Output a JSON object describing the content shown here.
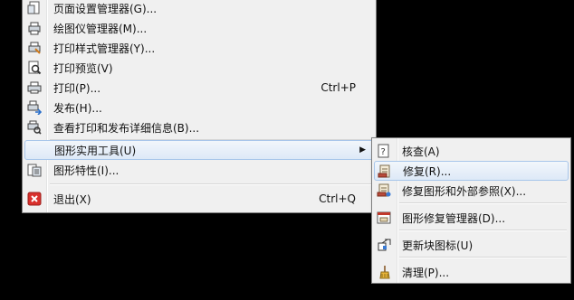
{
  "main_menu": {
    "items": [
      {
        "label": "页面设置管理器(G)...",
        "shortcut": "",
        "icon": "page-setup-icon"
      },
      {
        "label": "绘图仪管理器(M)...",
        "shortcut": "",
        "icon": "plotter-manager-icon"
      },
      {
        "label": "打印样式管理器(Y)...",
        "shortcut": "",
        "icon": "plot-style-icon"
      },
      {
        "label": "打印预览(V)",
        "shortcut": "",
        "icon": "print-preview-icon"
      },
      {
        "label": "打印(P)...",
        "shortcut": "Ctrl+P",
        "icon": "printer-icon"
      },
      {
        "label": "发布(H)...",
        "shortcut": "",
        "icon": "publish-icon"
      },
      {
        "label": "查看打印和发布详细信息(B)...",
        "shortcut": "",
        "icon": "plot-details-icon"
      },
      {
        "label": "图形实用工具(U)",
        "shortcut": "",
        "icon": ""
      },
      {
        "label": "图形特性(I)...",
        "shortcut": "",
        "icon": "drawing-properties-icon"
      },
      {
        "label": "退出(X)",
        "shortcut": "Ctrl+Q",
        "icon": "exit-icon"
      }
    ],
    "submenu_arrow": "▶"
  },
  "sub_menu": {
    "items": [
      {
        "label": "核查(A)",
        "icon": "audit-icon"
      },
      {
        "label": "修复(R)...",
        "icon": "recover-icon"
      },
      {
        "label": "修复图形和外部参照(X)...",
        "icon": "recover-xref-icon"
      },
      {
        "label": "图形修复管理器(D)...",
        "icon": "recovery-manager-icon"
      },
      {
        "label": "更新块图标(U)",
        "icon": "update-block-icon"
      },
      {
        "label": "清理(P)...",
        "icon": "purge-icon"
      }
    ]
  },
  "colors": {
    "highlight_border": "#a8c6ea",
    "menu_bg": "#f0f0f0",
    "exit_red": "#d9302c"
  }
}
